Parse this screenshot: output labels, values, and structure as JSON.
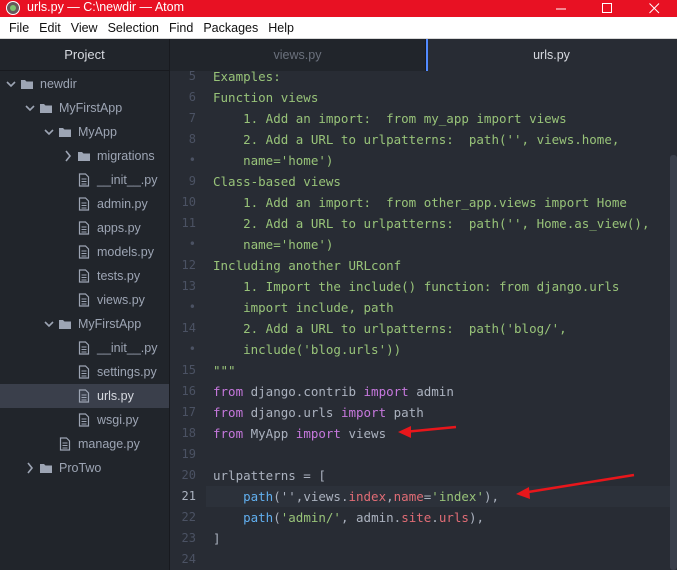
{
  "window": {
    "title": "urls.py — C:\\newdir — Atom",
    "accent": "#e81123",
    "minimize_glyph": "—",
    "maximize_glyph": "☐",
    "close_glyph": "✕"
  },
  "menu": [
    "File",
    "Edit",
    "View",
    "Selection",
    "Find",
    "Packages",
    "Help"
  ],
  "sidebar": {
    "title": "Project",
    "tree": [
      {
        "label": "newdir",
        "type": "folder",
        "depth": 0,
        "open": true
      },
      {
        "label": "MyFirstApp",
        "type": "folder",
        "depth": 1,
        "open": true
      },
      {
        "label": "MyApp",
        "type": "folder",
        "depth": 2,
        "open": true
      },
      {
        "label": "migrations",
        "type": "folder",
        "depth": 3,
        "open": false
      },
      {
        "label": "__init__.py",
        "type": "file",
        "depth": 3
      },
      {
        "label": "admin.py",
        "type": "file",
        "depth": 3
      },
      {
        "label": "apps.py",
        "type": "file",
        "depth": 3
      },
      {
        "label": "models.py",
        "type": "file",
        "depth": 3
      },
      {
        "label": "tests.py",
        "type": "file",
        "depth": 3
      },
      {
        "label": "views.py",
        "type": "file",
        "depth": 3
      },
      {
        "label": "MyFirstApp",
        "type": "folder",
        "depth": 2,
        "open": true
      },
      {
        "label": "__init__.py",
        "type": "file",
        "depth": 3
      },
      {
        "label": "settings.py",
        "type": "file",
        "depth": 3
      },
      {
        "label": "urls.py",
        "type": "file",
        "depth": 3,
        "selected": true
      },
      {
        "label": "wsgi.py",
        "type": "file",
        "depth": 3
      },
      {
        "label": "manage.py",
        "type": "file",
        "depth": 2
      },
      {
        "label": "ProTwo",
        "type": "folder",
        "depth": 1,
        "open": false
      }
    ]
  },
  "tabs": [
    {
      "label": "views.py",
      "active": false
    },
    {
      "label": "urls.py",
      "active": true
    }
  ],
  "editor": {
    "cursor_line_index": 16,
    "lines": [
      {
        "num": "5",
        "tokens": [
          [
            "doc",
            "Examples:"
          ]
        ]
      },
      {
        "num": "6",
        "tokens": [
          [
            "doc",
            "Function views"
          ]
        ]
      },
      {
        "num": "7",
        "tokens": [
          [
            "doc",
            "    1. Add an import:  from my_app import views"
          ]
        ]
      },
      {
        "num": "8",
        "tokens": [
          [
            "doc",
            "    2. Add a URL to urlpatterns:  path('', views.home,"
          ]
        ]
      },
      {
        "num": "•",
        "tokens": [
          [
            "doc",
            "    name='home')"
          ]
        ]
      },
      {
        "num": "9",
        "tokens": [
          [
            "doc",
            "Class-based views"
          ]
        ]
      },
      {
        "num": "10",
        "tokens": [
          [
            "doc",
            "    1. Add an import:  from other_app.views import Home"
          ]
        ]
      },
      {
        "num": "11",
        "tokens": [
          [
            "doc",
            "    2. Add a URL to urlpatterns:  path('', Home.as_view(),"
          ]
        ]
      },
      {
        "num": "•",
        "tokens": [
          [
            "doc",
            "    name='home')"
          ]
        ]
      },
      {
        "num": "12",
        "tokens": [
          [
            "doc",
            "Including another URLconf"
          ]
        ]
      },
      {
        "num": "13",
        "tokens": [
          [
            "doc",
            "    1. Import the include() function: from django.urls"
          ]
        ]
      },
      {
        "num": "•",
        "tokens": [
          [
            "doc",
            "    import include, path"
          ]
        ]
      },
      {
        "num": "14",
        "tokens": [
          [
            "doc",
            "    2. Add a URL to urlpatterns:  path('blog/',"
          ]
        ]
      },
      {
        "num": "•",
        "tokens": [
          [
            "doc",
            "    include('blog.urls'))"
          ]
        ]
      },
      {
        "num": "15",
        "tokens": [
          [
            "doc",
            "\"\"\""
          ]
        ]
      },
      {
        "num": "16",
        "tokens": [
          [
            "kw",
            "from"
          ],
          [
            "plain",
            " django.contrib "
          ],
          [
            "kw",
            "import"
          ],
          [
            "plain",
            " admin"
          ]
        ]
      },
      {
        "num": "17",
        "tokens": [
          [
            "kw",
            "from"
          ],
          [
            "plain",
            " django.urls "
          ],
          [
            "kw",
            "import"
          ],
          [
            "plain",
            " path"
          ]
        ]
      },
      {
        "num": "18",
        "tokens": [
          [
            "kw",
            "from"
          ],
          [
            "plain",
            " MyApp "
          ],
          [
            "kw",
            "import"
          ],
          [
            "plain",
            " views"
          ]
        ]
      },
      {
        "num": "19",
        "tokens": [
          [
            "plain",
            ""
          ]
        ]
      },
      {
        "num": "20",
        "tokens": [
          [
            "plain",
            "urlpatterns = ["
          ]
        ]
      },
      {
        "num": "21",
        "tokens": [
          [
            "plain",
            "    "
          ],
          [
            "fn",
            "path"
          ],
          [
            "plain",
            "(''"
          ],
          [
            "plain",
            ",views."
          ],
          [
            "prop",
            "index"
          ],
          [
            "plain",
            ","
          ],
          [
            "prop",
            "name"
          ],
          [
            "plain",
            "="
          ],
          [
            "str",
            "'index'"
          ],
          [
            "plain",
            "),"
          ]
        ]
      },
      {
        "num": "22",
        "tokens": [
          [
            "plain",
            "    "
          ],
          [
            "fn",
            "path"
          ],
          [
            "plain",
            "("
          ],
          [
            "str",
            "'admin/'"
          ],
          [
            "plain",
            ", admin."
          ],
          [
            "prop",
            "site"
          ],
          [
            "plain",
            "."
          ],
          [
            "prop",
            "urls"
          ],
          [
            "plain",
            "),"
          ]
        ]
      },
      {
        "num": "23",
        "tokens": [
          [
            "plain",
            "]"
          ]
        ]
      },
      {
        "num": "24",
        "tokens": [
          [
            "plain",
            ""
          ]
        ]
      }
    ]
  },
  "annotations": {
    "arrow_color": "#e8161b"
  }
}
